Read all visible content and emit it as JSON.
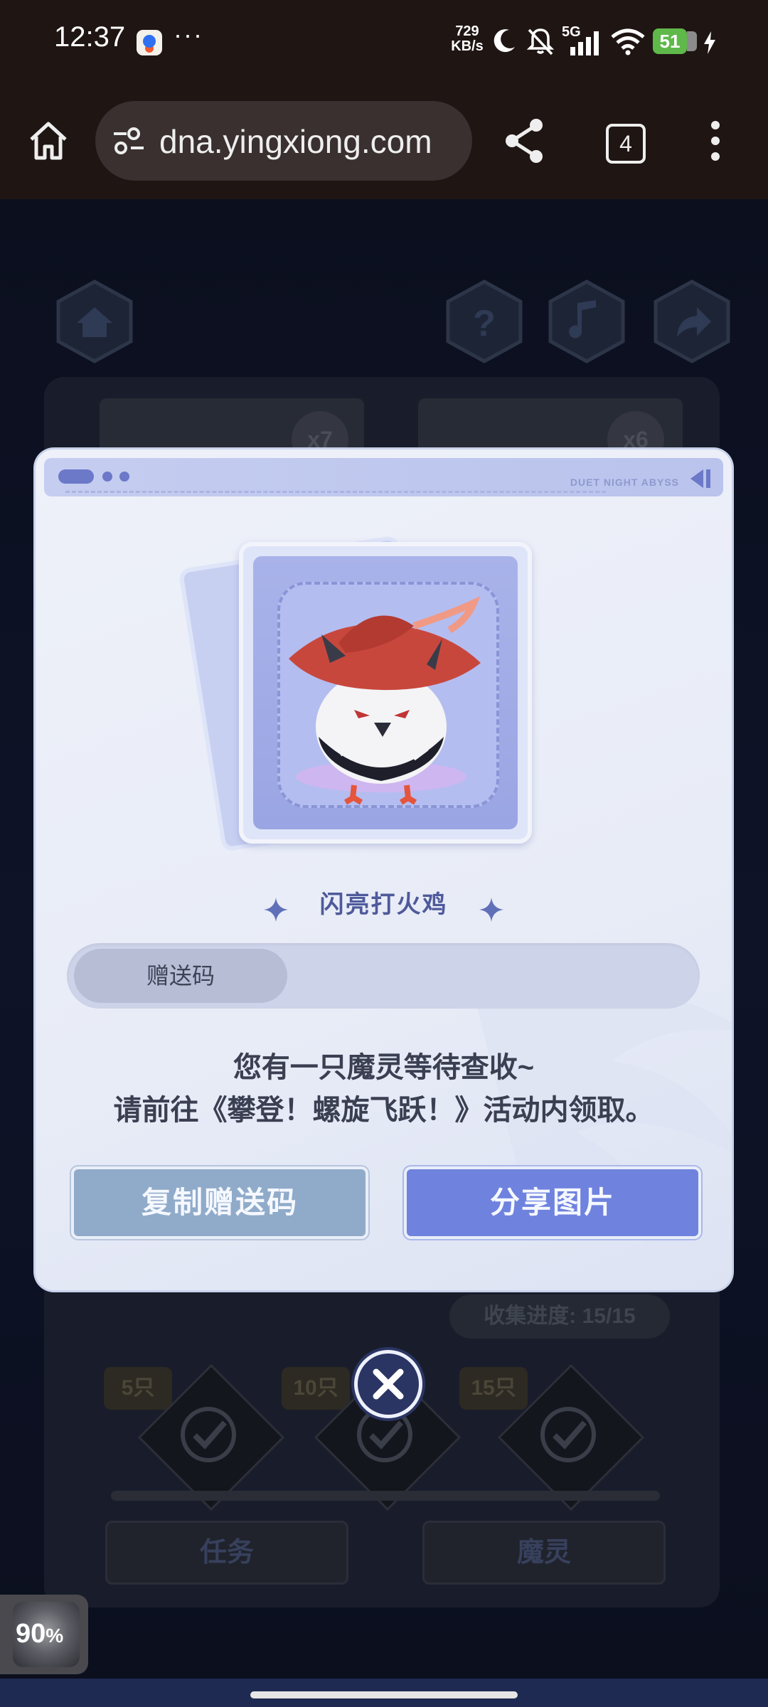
{
  "status_bar": {
    "time": "12:37",
    "overflow": "···",
    "net_speed_value": "729",
    "net_speed_unit": "KB/s",
    "network": "5G",
    "battery": "51"
  },
  "browser": {
    "url": "dna.yingxiong.com",
    "tab_count": "4"
  },
  "background": {
    "card_counts": [
      "x7",
      "x6"
    ],
    "progress_text": "收集进度: 15/15",
    "milestones": [
      "5只",
      "10只",
      "15只"
    ],
    "tab_task": "任务",
    "tab_spirit": "魔灵"
  },
  "dialog": {
    "header_brand": "DUET NIGHT ABYSS",
    "pet_name": "闪亮打火鸡",
    "code_label": "赠送码",
    "code_value": "",
    "message_line1": "您有一只魔灵等待查收~",
    "message_line2": "请前往《攀登！螺旋飞跃！》活动内领取。",
    "copy_button": "复制赠送码",
    "share_button": "分享图片"
  },
  "floating_widget": {
    "percent": "90",
    "percent_sign": "%"
  },
  "colors": {
    "dialog_bg": "#e6ebf6",
    "copy_button": "#90abc9",
    "share_button": "#6f82de",
    "title_text": "#4e5a9a",
    "statusbar_bg": "#1f1513"
  },
  "icons": {
    "home": "home-icon",
    "site_settings": "tune-icon",
    "share": "share-icon",
    "menu": "more-vert-icon",
    "close": "close-icon"
  }
}
